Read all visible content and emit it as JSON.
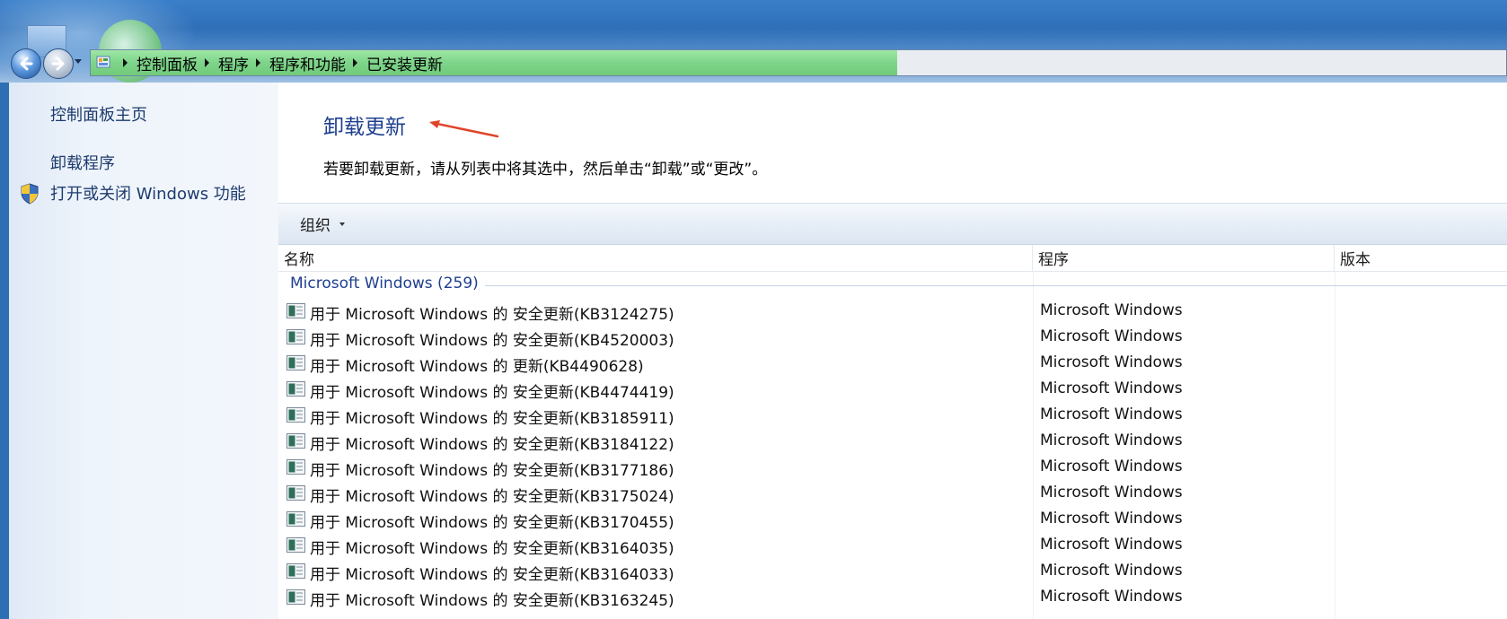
{
  "breadcrumb": [
    "控制面板",
    "程序",
    "程序和功能",
    "已安装更新"
  ],
  "sidebar": {
    "home_link": "控制面板主页",
    "uninstall_link": "卸载程序",
    "features_link": "打开或关闭 Windows 功能"
  },
  "main": {
    "title": "卸载更新",
    "description": "若要卸载更新，请从列表中将其选中，然后单击“卸载”或“更改”。"
  },
  "toolbar": {
    "organize_label": "组织"
  },
  "list": {
    "columns": [
      "名称",
      "程序",
      "版本"
    ],
    "group": "Microsoft Windows (259)",
    "rows": [
      {
        "name": "用于 Microsoft Windows 的 安全更新(KB3124275)",
        "program": "Microsoft Windows"
      },
      {
        "name": "用于 Microsoft Windows 的 安全更新(KB4520003)",
        "program": "Microsoft Windows"
      },
      {
        "name": "用于 Microsoft Windows 的 更新(KB4490628)",
        "program": "Microsoft Windows"
      },
      {
        "name": "用于 Microsoft Windows 的 安全更新(KB4474419)",
        "program": "Microsoft Windows"
      },
      {
        "name": "用于 Microsoft Windows 的 安全更新(KB3185911)",
        "program": "Microsoft Windows"
      },
      {
        "name": "用于 Microsoft Windows 的 安全更新(KB3184122)",
        "program": "Microsoft Windows"
      },
      {
        "name": "用于 Microsoft Windows 的 安全更新(KB3177186)",
        "program": "Microsoft Windows"
      },
      {
        "name": "用于 Microsoft Windows 的 安全更新(KB3175024)",
        "program": "Microsoft Windows"
      },
      {
        "name": "用于 Microsoft Windows 的 安全更新(KB3170455)",
        "program": "Microsoft Windows"
      },
      {
        "name": "用于 Microsoft Windows 的 安全更新(KB3164035)",
        "program": "Microsoft Windows"
      },
      {
        "name": "用于 Microsoft Windows 的 安全更新(KB3164033)",
        "program": "Microsoft Windows"
      },
      {
        "name": "用于 Microsoft Windows 的 安全更新(KB3163245)",
        "program": "Microsoft Windows"
      }
    ]
  },
  "colors": {
    "link": "#1e3b6e",
    "title": "#1e3f8f",
    "annotation_arrow": "#e0452a"
  }
}
